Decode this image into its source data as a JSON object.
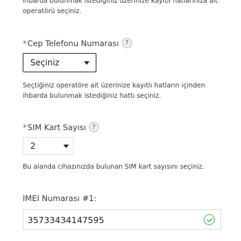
{
  "intro_text": {
    "line1": "ihbarda bulunmak istediğiniz üzerinize kayıtlı hatlarınıza ait",
    "line2": "operatörü seçiniz."
  },
  "phone_field": {
    "required_mark": "*",
    "label": "Cep Telefonu Numarası",
    "help_icon": "?",
    "selected": "Seçiniz",
    "hint_line1": "Seçtiğiniz operatöre ait üzerinize kayıtlı hatların içinden",
    "hint_line2": "ihbarda bulunmak istediğiniz hattı seçiniz."
  },
  "sim_field": {
    "required_mark": "*",
    "label": "SIM Kart Sayısı",
    "help_icon": "?",
    "selected": "2",
    "hint": "Bu alanda cihazınızda bulunan SIM kart sayısını seçiniz."
  },
  "imei_field": {
    "label": "IMEI Numarası #1:",
    "value": "35733434147595",
    "status_icon": "check-circle-icon",
    "status_color": "#4caf50"
  }
}
